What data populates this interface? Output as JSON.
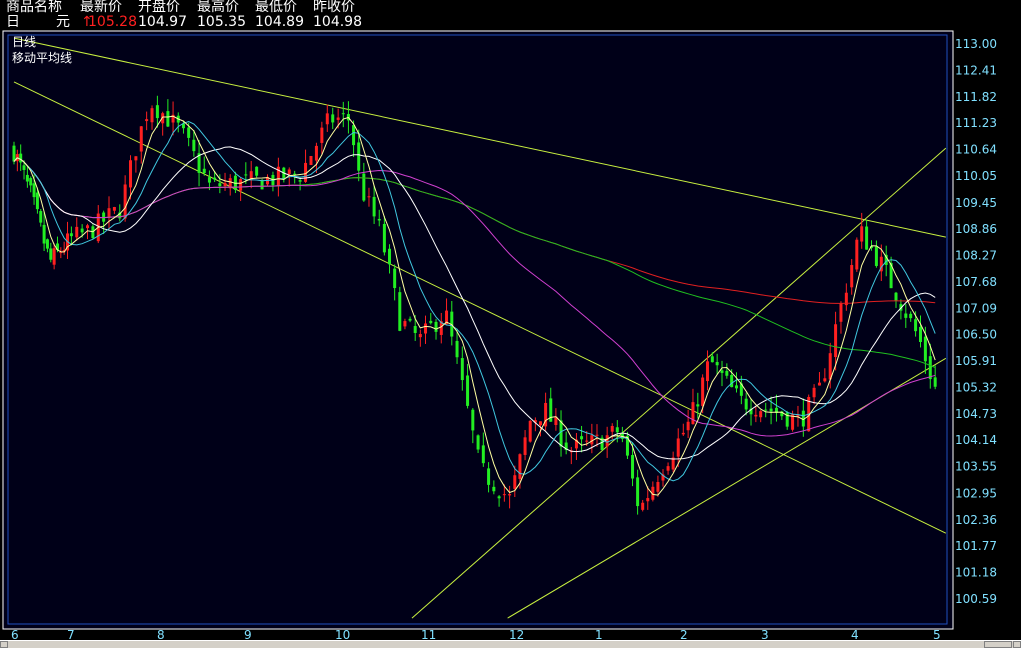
{
  "header": {
    "labels": [
      "商品名称",
      "最新价",
      "开盘价",
      "最高价",
      "最低价",
      "昨收价"
    ],
    "name": "日",
    "unit": "元",
    "last": "105.28",
    "open": "104.97",
    "high": "105.35",
    "low": "104.89",
    "prev_close": "104.98",
    "up_arrow": "↑"
  },
  "panel": {
    "period": "日线",
    "indicator": "移动平均线"
  },
  "colors": {
    "up": "#ff2020",
    "down": "#22ee22",
    "ma5": "#ffffa0",
    "ma10": "#40c8e0",
    "ma20": "#ffffff",
    "ma60": "#d040d0",
    "ma120": "#20c020",
    "ma250": "#e02020",
    "trend": "#c8f040",
    "axis": "#80e0ff",
    "border": "#2050c0"
  },
  "chart_data": {
    "type": "candlestick",
    "x_tick_labels": [
      "6",
      "7",
      "8",
      "9",
      "10",
      "11",
      "12",
      "1",
      "2",
      "3",
      "4",
      "5"
    ],
    "y_tick_labels": [
      "113.00",
      "112.41",
      "111.82",
      "111.23",
      "110.64",
      "110.05",
      "109.45",
      "108.86",
      "108.27",
      "107.68",
      "107.09",
      "106.50",
      "105.91",
      "105.32",
      "104.73",
      "104.14",
      "103.55",
      "102.95",
      "102.36",
      "101.77",
      "101.18",
      "100.59"
    ],
    "ylim": [
      100.59,
      113.0
    ],
    "close_path_month_price": [
      [
        0,
        110.6
      ],
      [
        0.3,
        109.6
      ],
      [
        0.64,
        108.1
      ],
      [
        1.0,
        108.6
      ],
      [
        1.22,
        108.8
      ],
      [
        1.56,
        109.3
      ],
      [
        1.75,
        110.8
      ],
      [
        1.89,
        111.7
      ],
      [
        2.23,
        111.05
      ],
      [
        2.57,
        109.8
      ],
      [
        3.03,
        109.9
      ],
      [
        3.58,
        110.05
      ],
      [
        3.91,
        111.3
      ],
      [
        4.14,
        111.3
      ],
      [
        4.26,
        109.8
      ],
      [
        4.49,
        108.8
      ],
      [
        4.72,
        106.8
      ],
      [
        4.95,
        106.35
      ],
      [
        5.24,
        107.0
      ],
      [
        5.47,
        105.0
      ],
      [
        5.64,
        103.45
      ],
      [
        5.98,
        102.8
      ],
      [
        6.21,
        104.55
      ],
      [
        6.38,
        104.8
      ],
      [
        6.67,
        103.9
      ],
      [
        7.02,
        104.1
      ],
      [
        7.26,
        104.35
      ],
      [
        7.49,
        102.55
      ],
      [
        7.73,
        103.45
      ],
      [
        8.09,
        104.55
      ],
      [
        8.33,
        105.9
      ],
      [
        8.7,
        105.0
      ],
      [
        9.07,
        104.8
      ],
      [
        9.4,
        104.55
      ],
      [
        9.62,
        105.25
      ],
      [
        9.84,
        107.0
      ],
      [
        10.07,
        108.8
      ],
      [
        10.32,
        108.1
      ],
      [
        10.56,
        107.25
      ],
      [
        10.8,
        106.35
      ],
      [
        10.99,
        105.28
      ]
    ],
    "candles": 185,
    "moving_averages": [
      5,
      10,
      20,
      60,
      120,
      250
    ],
    "trend_lines": [
      {
        "from": [
          0,
          113.11
        ],
        "to": [
          11.12,
          108.66
        ]
      },
      {
        "from": [
          0,
          112.13
        ],
        "to": [
          11.12,
          102.04
        ]
      },
      {
        "from": [
          4.86,
          100.14
        ],
        "to": [
          11.12,
          110.65
        ]
      },
      {
        "from": [
          5.95,
          100.14
        ],
        "to": [
          11.12,
          105.95
        ]
      }
    ]
  }
}
